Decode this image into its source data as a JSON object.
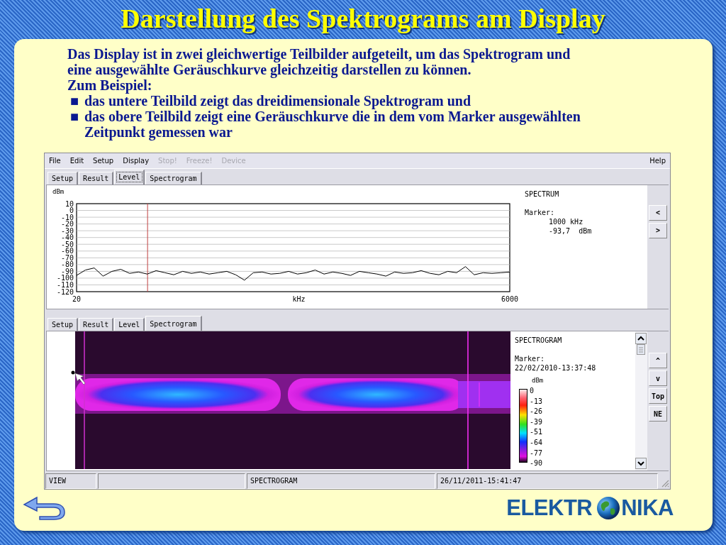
{
  "title": "Darstellung des Spektrograms am Display",
  "intro": "Das Display ist in zwei gleichwertige Teilbilder aufgeteilt, um das Spektrogram und eine ausgewählte Geräuschkurve gleichzeitig darstellen zu können.",
  "example_heading": "Zum Beispiel:",
  "bullets": [
    {
      "marker": "■",
      "text": "das untere Teilbild zeigt das dreidimensionale Spektrogram und"
    },
    {
      "marker": "■",
      "text": "das obere Teilbild zeigt eine Geräuschkurve die in dem vom Marker ausgewählten Zeitpunkt gemessen war"
    }
  ],
  "app": {
    "menu": [
      {
        "label": "File",
        "disabled": false
      },
      {
        "label": "Edit",
        "disabled": false
      },
      {
        "label": "Setup",
        "disabled": false
      },
      {
        "label": "Display",
        "disabled": false
      },
      {
        "label": "Stop!",
        "disabled": true
      },
      {
        "label": "Freeze!",
        "disabled": true
      },
      {
        "label": "Device",
        "disabled": true
      }
    ],
    "help_menu": {
      "label": "Help",
      "disabled": false
    },
    "top_pane": {
      "tabs": [
        {
          "label": "Setup",
          "selected": false
        },
        {
          "label": "Result",
          "selected": false
        },
        {
          "label": "Level",
          "selected": true
        },
        {
          "label": "Spectrogram",
          "selected": false
        }
      ],
      "chart_data": {
        "type": "line",
        "xlabel": "kHz",
        "ylabel": "dBm",
        "x": [
          20,
          142,
          264,
          386,
          508,
          630,
          752,
          874,
          996,
          1118,
          1240,
          1362,
          1484,
          1606,
          1728,
          1850,
          1972,
          2094,
          2216,
          2338,
          2460,
          2582,
          2704,
          2826,
          2948,
          3070,
          3192,
          3314,
          3436,
          3558,
          3680,
          3802,
          3924,
          4046,
          4168,
          4290,
          4412,
          4534,
          4656,
          4778,
          4900,
          5022,
          5144,
          5266,
          5388,
          5510,
          5632,
          5754,
          5876,
          6000
        ],
        "series": [
          {
            "color": "#000000",
            "values": [
              -96,
              -88,
              -85,
              -97,
              -90,
              -87,
              -93,
              -91,
              -94,
              -89,
              -92,
              -95,
              -90,
              -93,
              -91,
              -94,
              -92,
              -90,
              -95,
              -103,
              -92,
              -91,
              -94,
              -93,
              -90,
              -94,
              -92,
              -88,
              -94,
              -91,
              -93,
              -96,
              -90,
              -92,
              -94,
              -97,
              -91,
              -93,
              -92,
              -89,
              -93,
              -95,
              -90,
              -92,
              -83,
              -95,
              -92,
              -93,
              -92,
              -91
            ]
          }
        ],
        "xlim": [
          20,
          6000
        ],
        "ylim": [
          -120,
          10
        ],
        "xticks": [
          {
            "value": 20,
            "label": "20"
          },
          {
            "value": 6000,
            "label": "6000"
          }
        ],
        "yticks": [
          10,
          0,
          -10,
          -20,
          -30,
          -40,
          -50,
          -60,
          -70,
          -80,
          -90,
          -100,
          -110,
          -120
        ],
        "grid": true,
        "ref_lines": [
          {
            "axis": "x",
            "value": 1000,
            "color": "#c04040"
          }
        ]
      },
      "info": {
        "title": "SPECTRUM",
        "marker_label": "Marker:",
        "marker_lines": [
          "1000 kHz",
          "-93,7  dBm"
        ]
      },
      "buttons": [
        "<",
        ">"
      ]
    },
    "bottom_pane": {
      "tabs": [
        {
          "label": "Setup",
          "selected": false
        },
        {
          "label": "Result",
          "selected": false
        },
        {
          "label": "Level",
          "selected": false
        },
        {
          "label": "Spectrogram",
          "selected": true
        }
      ],
      "info": {
        "title": "SPECTROGRAM",
        "marker_label": "Marker:",
        "marker_value": "22/02/2010-13:37:48",
        "scale_unit": "dBm",
        "scale_labels": [
          "0",
          "-13",
          "-26",
          "-39",
          "-51",
          "-64",
          "-77",
          "-90"
        ]
      },
      "buttons": [
        "^",
        "v",
        "Top",
        "NE"
      ]
    },
    "status_bar": {
      "mode": "VIEW",
      "view": "SPECTROGRAM",
      "timestamp": "26/11/2011-15:41:47"
    }
  },
  "logo": {
    "left": "ELEKTR",
    "right": "NIKA"
  }
}
